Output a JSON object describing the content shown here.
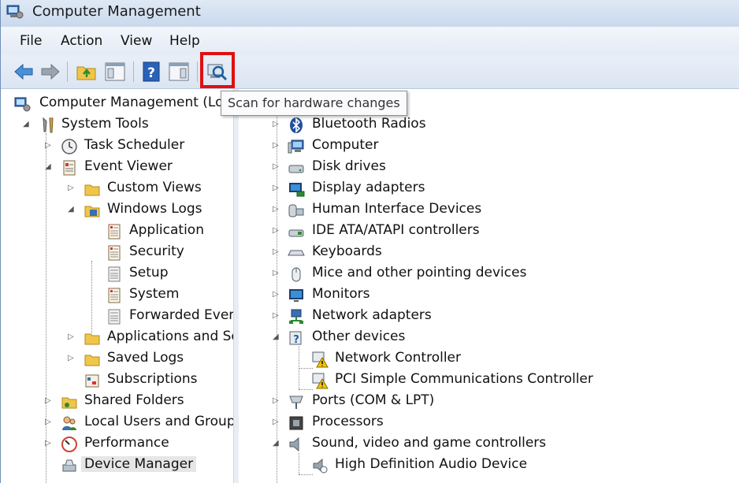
{
  "window": {
    "title": "Computer Management"
  },
  "menu": [
    "File",
    "Action",
    "View",
    "Help"
  ],
  "toolbar": {
    "buttons": [
      "back-arrow-icon",
      "forward-arrow-icon",
      "up-folder-icon",
      "show-hide-console-tree-icon",
      "help-icon",
      "show-hide-action-pane-icon",
      "scan-hardware-icon"
    ],
    "tooltip": "Scan for hardware changes",
    "highlight_color": "#e01010"
  },
  "tree": {
    "root": "Computer Management (Loc",
    "system_tools": "System Tools",
    "task_scheduler": "Task Scheduler",
    "event_viewer": "Event Viewer",
    "custom_views": "Custom Views",
    "windows_logs": "Windows Logs",
    "application": "Application",
    "security": "Security",
    "setup": "Setup",
    "system": "System",
    "forwarded_events": "Forwarded Event",
    "apps_services": "Applications and Se",
    "saved_logs": "Saved Logs",
    "subscriptions": "Subscriptions",
    "shared_folders": "Shared Folders",
    "local_users": "Local Users and Groups",
    "performance": "Performance",
    "device_manager": "Device Manager"
  },
  "devices": {
    "bluetooth": "Bluetooth Radios",
    "computer": "Computer",
    "disk_drives": "Disk drives",
    "display_adapters": "Display adapters",
    "hid": "Human Interface Devices",
    "ide": "IDE ATA/ATAPI controllers",
    "keyboards": "Keyboards",
    "mice": "Mice and other pointing devices",
    "monitors": "Monitors",
    "network_adapters": "Network adapters",
    "other_devices": "Other devices",
    "network_controller": "Network Controller",
    "pci_controller": "PCI Simple Communications Controller",
    "ports": "Ports (COM & LPT)",
    "processors": "Processors",
    "sound": "Sound, video and game controllers",
    "hd_audio": "High Definition Audio Device"
  }
}
